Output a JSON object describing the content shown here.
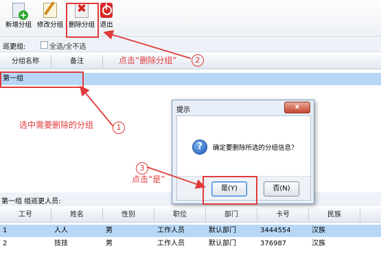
{
  "toolbar": {
    "new_label": "新增分组",
    "edit_label": "修改分组",
    "delete_label": "删除分组",
    "exit_label": "退出"
  },
  "groupbar": {
    "label": "巡更组:",
    "checkbox_label": "全选/全不选"
  },
  "group_grid": {
    "headers": [
      "分组名称",
      "备注"
    ],
    "rows": [
      [
        "第一组",
        ""
      ]
    ]
  },
  "member_section": {
    "title": "第一组 组巡更人员:",
    "headers": [
      "工号",
      "姓名",
      "性别",
      "职位",
      "部门",
      "卡号",
      "民族"
    ],
    "rows": [
      [
        "1",
        "人人",
        "男",
        "工作人员",
        "默认部门",
        "3444554",
        "汉族"
      ],
      [
        "2",
        "技技",
        "男",
        "工作人员",
        "默认部门",
        "376987",
        "汉族"
      ]
    ]
  },
  "dialog": {
    "title": "提示",
    "close_label": "x",
    "message": "确定要删除所选的分组信息？",
    "yes_label": "是(Y)",
    "no_label": "否(N)"
  },
  "annotations": {
    "step1_text": "选中需要删除的分组",
    "step1_num": "1",
    "step2_text": "点击“删除分组”",
    "step2_num": "2",
    "step3_text": "点击“是”",
    "step3_num": "3"
  },
  "colors": {
    "annotation": "#e03a3a",
    "selected_row": "#b8d7f6",
    "dialog_bg": "#e7eef7"
  }
}
